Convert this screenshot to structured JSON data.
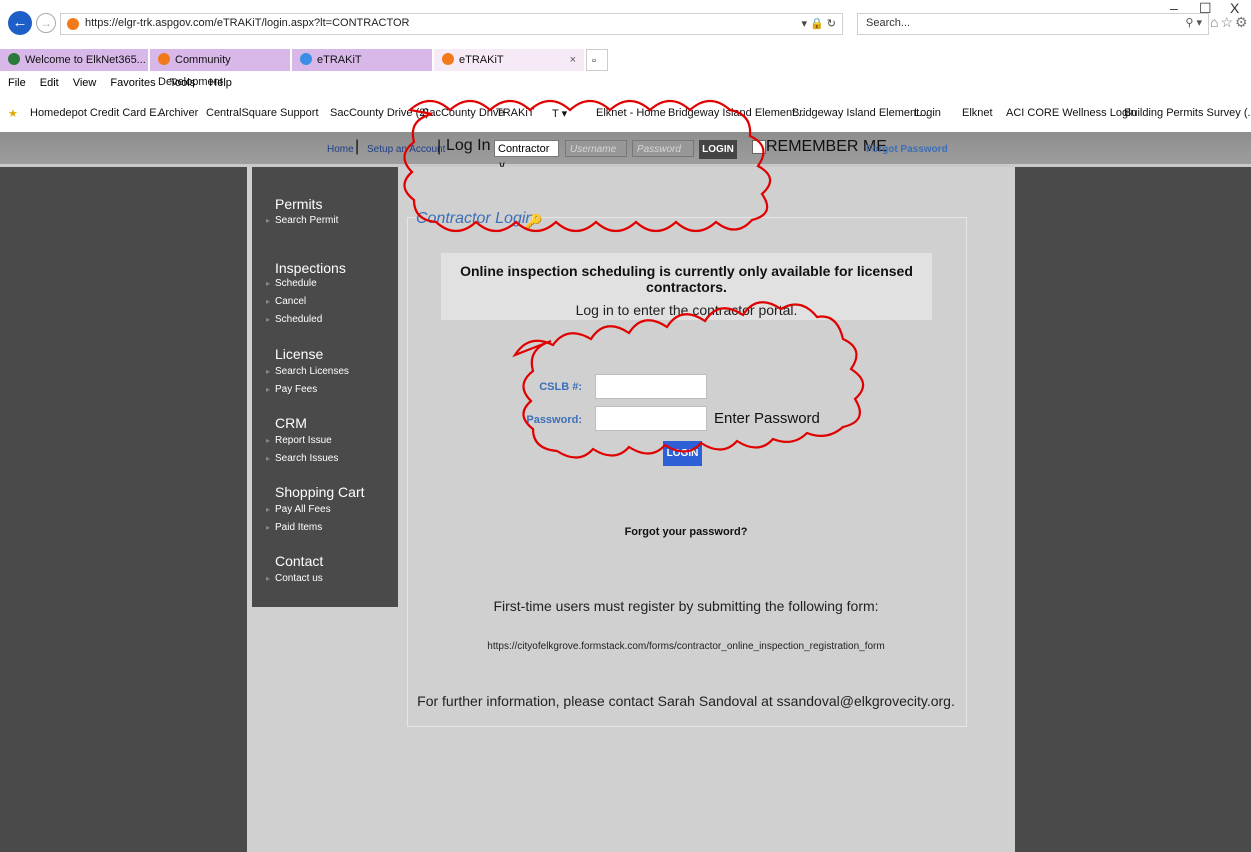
{
  "browser": {
    "url": "https://elgr-trk.aspgov.com/eTRAKiT/login.aspx?lt=CONTRACTOR",
    "search_placeholder": "Search...",
    "window_controls": [
      "–",
      "☐",
      "X"
    ],
    "tabs": [
      {
        "label": "Welcome to ElkNet365..."
      },
      {
        "label": "Community Development"
      },
      {
        "label": "eTRAKiT"
      },
      {
        "label": "eTRAKiT",
        "close": "×"
      }
    ],
    "menu": [
      "File",
      "Edit",
      "View",
      "Favorites",
      "Tools",
      "Help"
    ],
    "favorites": [
      "Homedepot Credit Card E...",
      "Archiver",
      "CentralSquare Support",
      "SacCounty Drive (2)",
      "SacCounty Drive",
      "TRAKiT",
      "T ▾",
      "Elknet - Home",
      "Bridgeway Island Element...",
      "Bridgeway Island Element...",
      "Login",
      "Elknet",
      "ACI CORE Wellness Login",
      "Building Permits Survey (..."
    ]
  },
  "header": {
    "home": "Home",
    "setup_account": "Setup an Account",
    "login_label": "Log In",
    "role_selected": "Contractor",
    "username_placeholder": "Username",
    "password_placeholder": "Password",
    "login_button": "LOGIN",
    "remember_me": "REMEMBER ME",
    "forgot_password": "Forgot Password"
  },
  "nav": {
    "sections": [
      {
        "title": "Permits",
        "items": [
          "Search Permit"
        ]
      },
      {
        "title": "Inspections",
        "items": [
          "Schedule",
          "Cancel",
          "Scheduled"
        ]
      },
      {
        "title": "License",
        "items": [
          "Search Licenses",
          "Pay Fees"
        ]
      },
      {
        "title": "CRM",
        "items": [
          "Report Issue",
          "Search Issues"
        ]
      },
      {
        "title": "Shopping Cart",
        "items": [
          "Pay All Fees",
          "Paid Items"
        ]
      },
      {
        "title": "Contact",
        "items": [
          "Contact us"
        ]
      }
    ]
  },
  "main": {
    "title": "Contractor Login",
    "notice": "Online inspection scheduling is currently only available for licensed contractors.",
    "subnotice": "Log in to enter the contractor portal.",
    "cslb_label": "CSLB #:",
    "password_label": "Password:",
    "enter_password_note": "Enter Password",
    "login_button": "LOGIN",
    "forgot": "Forgot your password?",
    "first_time": "First-time users must register by submitting the following form:",
    "form_url": "https://cityofelkgrove.formstack.com/forms/contractor_online_inspection_registration_form",
    "further_info": "For further information, please contact Sarah Sandoval at ssandoval@elkgrovecity.org."
  },
  "colors": {
    "annotation": "#e00000",
    "link": "#1f3e8a",
    "accent": "#3d6fb8",
    "button": "#2d5fd6"
  }
}
